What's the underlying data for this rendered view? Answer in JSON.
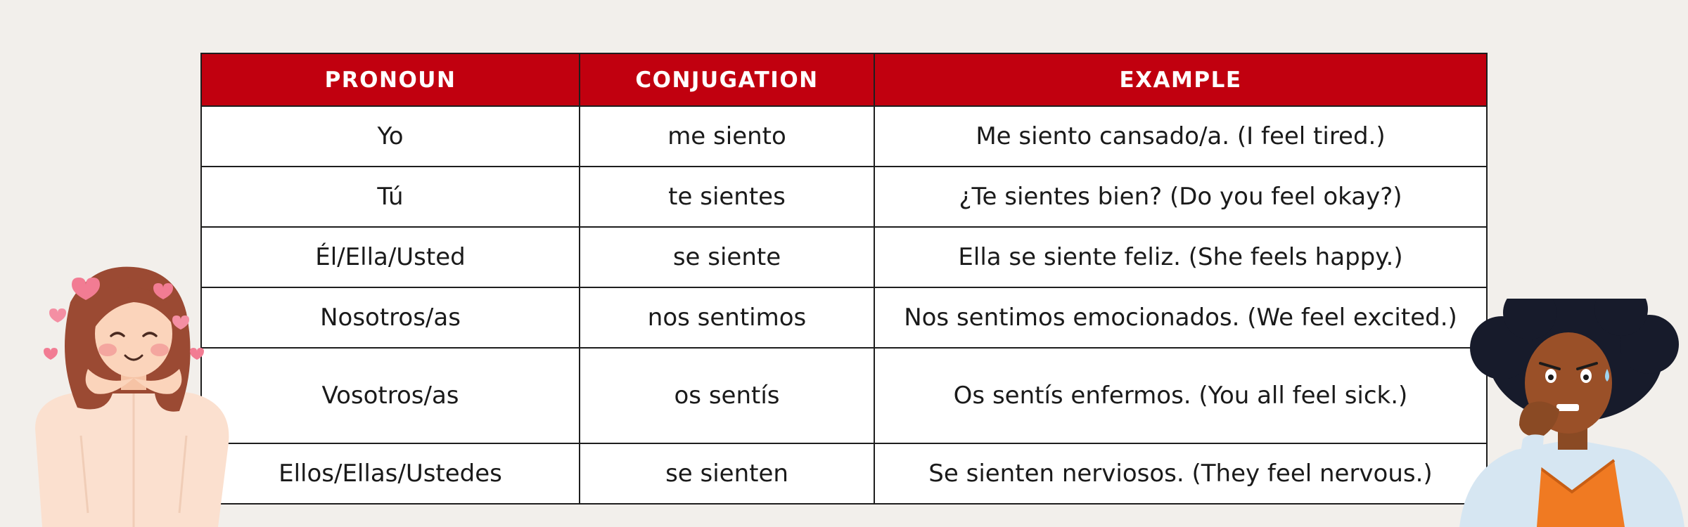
{
  "table": {
    "headers": [
      "PRONOUN",
      "CONJUGATION",
      "EXAMPLE"
    ],
    "rows": [
      {
        "pronoun": "Yo",
        "conjugation": "me siento",
        "example": "Me siento cansado/a. (I feel tired.)"
      },
      {
        "pronoun": "Tú",
        "conjugation": "te sientes",
        "example": "¿Te sientes bien? (Do you feel okay?)"
      },
      {
        "pronoun": "Él/Ella/Usted",
        "conjugation": "se siente",
        "example": "Ella se siente feliz. (She feels happy.)"
      },
      {
        "pronoun": "Nosotros/as",
        "conjugation": "nos sentimos",
        "example": "Nos sentimos emocionados. (We feel excited.)"
      },
      {
        "pronoun": "Vosotros/as",
        "conjugation": "os sentís",
        "example": "Os sentís enfermos. (You all feel sick.)"
      },
      {
        "pronoun": "Ellos/Ellas/Ustedes",
        "conjugation": "se sienten",
        "example": "Se sienten nerviosos. (They feel nervous.)"
      }
    ]
  },
  "colors": {
    "header_background": "#c1000f",
    "header_text": "#ffffff",
    "page_background": "#f2efeb",
    "border": "#1e1e1e"
  },
  "illustrations": {
    "left": "happy-girl-hearts-illustration",
    "right": "nervous-person-biting-nails-illustration"
  }
}
